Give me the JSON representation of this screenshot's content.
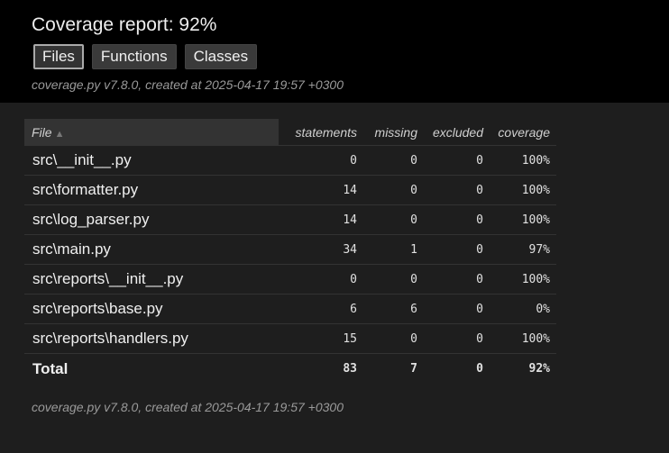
{
  "header": {
    "title": "Coverage report: 92%",
    "tabs": [
      {
        "label": "Files",
        "active": true
      },
      {
        "label": "Functions",
        "active": false
      },
      {
        "label": "Classes",
        "active": false
      }
    ],
    "created": "coverage.py v7.8.0, created at 2025-04-17 19:57 +0300"
  },
  "table": {
    "columns": {
      "file": "File",
      "sort_indicator": "▲",
      "statements": "statements",
      "missing": "missing",
      "excluded": "excluded",
      "coverage": "coverage"
    },
    "rows": [
      {
        "file": "src\\__init__.py",
        "statements": "0",
        "missing": "0",
        "excluded": "0",
        "coverage": "100%"
      },
      {
        "file": "src\\formatter.py",
        "statements": "14",
        "missing": "0",
        "excluded": "0",
        "coverage": "100%"
      },
      {
        "file": "src\\log_parser.py",
        "statements": "14",
        "missing": "0",
        "excluded": "0",
        "coverage": "100%"
      },
      {
        "file": "src\\main.py",
        "statements": "34",
        "missing": "1",
        "excluded": "0",
        "coverage": "97%"
      },
      {
        "file": "src\\reports\\__init__.py",
        "statements": "0",
        "missing": "0",
        "excluded": "0",
        "coverage": "100%"
      },
      {
        "file": "src\\reports\\base.py",
        "statements": "6",
        "missing": "6",
        "excluded": "0",
        "coverage": "0%"
      },
      {
        "file": "src\\reports\\handlers.py",
        "statements": "15",
        "missing": "0",
        "excluded": "0",
        "coverage": "100%"
      }
    ],
    "total": {
      "label": "Total",
      "statements": "83",
      "missing": "7",
      "excluded": "0",
      "coverage": "92%"
    }
  },
  "footer": {
    "created": "coverage.py v7.8.0, created at 2025-04-17 19:57 +0300"
  },
  "colors": {
    "header_bg": "#000000",
    "page_bg": "#1e1e1e",
    "file_header_bg": "#333333",
    "button_bg": "#3a3a3a",
    "text": "#e6e6e6",
    "muted_text": "#9a9a9a"
  }
}
